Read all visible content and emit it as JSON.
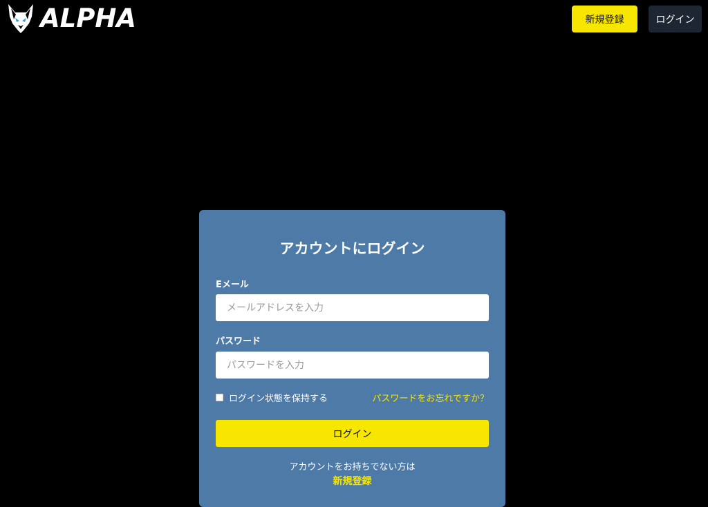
{
  "header": {
    "logo_text": "ALPHA",
    "register_label": "新規登録",
    "login_label": "ログイン"
  },
  "login_card": {
    "title": "アカウントにログイン",
    "email": {
      "label": "Eメール",
      "placeholder": "メールアドレスを入力",
      "value": ""
    },
    "password": {
      "label": "パスワード",
      "placeholder": "パスワードを入力",
      "value": ""
    },
    "remember_label": "ログイン状態を保持する",
    "remember_checked": false,
    "forgot_label": "パスワードをお忘れですか？",
    "submit_label": "ログイン",
    "no_account_text": "アカウントをお持ちでない方は",
    "register_link_label": "新規登録"
  },
  "colors": {
    "background": "#000000",
    "accent_yellow": "#f7e600",
    "card_blue": "#4e7aa8",
    "dark_button": "#1f2633"
  },
  "icons": {
    "logo": "wolf-head-icon"
  }
}
